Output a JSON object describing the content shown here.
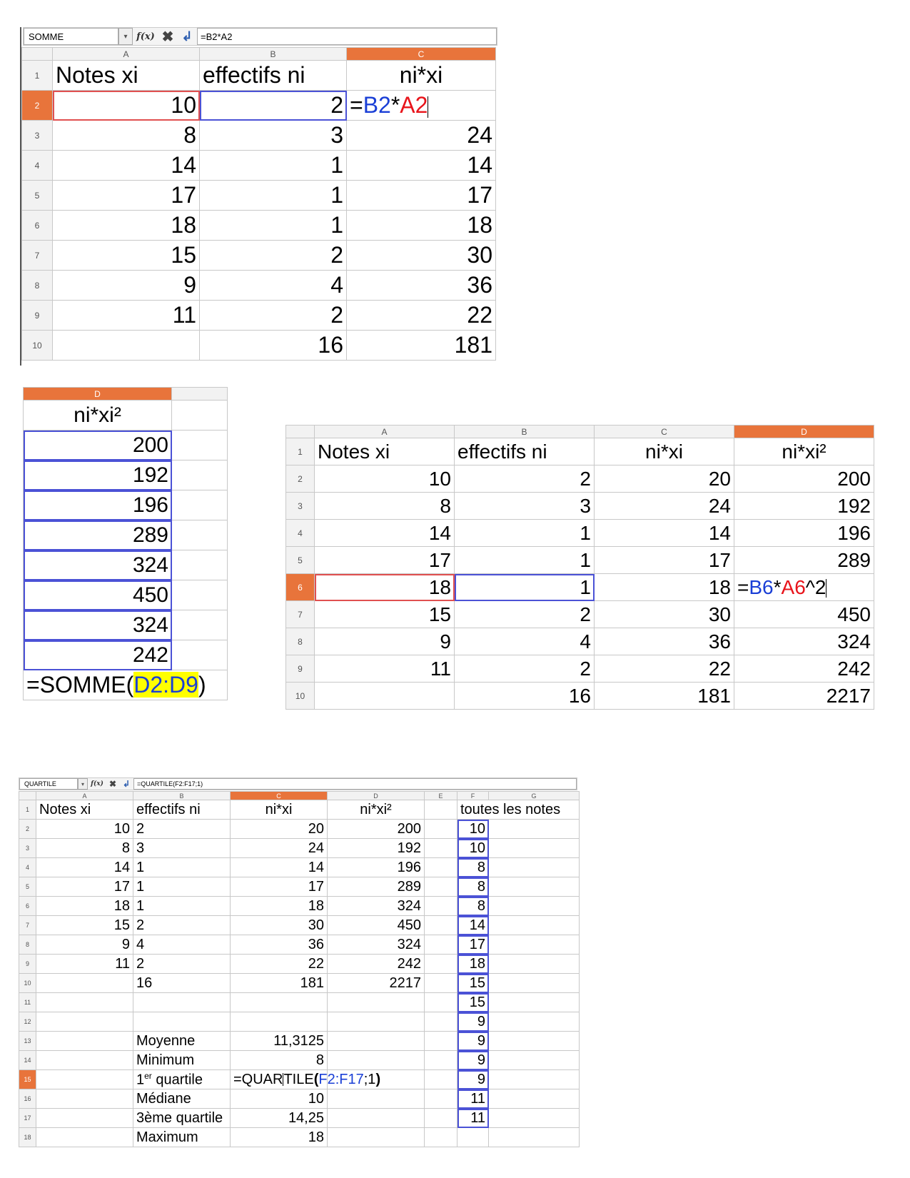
{
  "panel1": {
    "namebox": "SOMME",
    "formula": "=B2*A2",
    "col_headers": [
      "A",
      "B",
      "C"
    ],
    "header_row": [
      "Notes xi",
      "effectifs ni",
      "ni*xi"
    ],
    "row_numbers": [
      "1",
      "2",
      "3",
      "4",
      "5",
      "6",
      "7",
      "8",
      "9",
      "10"
    ],
    "edit_formula": {
      "eq": "=",
      "ref1": "B2",
      "op": "*",
      "ref2": "A2"
    },
    "rows": [
      [
        "10",
        "2",
        ""
      ],
      [
        "8",
        "3",
        "24"
      ],
      [
        "14",
        "1",
        "14"
      ],
      [
        "17",
        "1",
        "17"
      ],
      [
        "18",
        "1",
        "18"
      ],
      [
        "15",
        "2",
        "30"
      ],
      [
        "9",
        "4",
        "36"
      ],
      [
        "11",
        "2",
        "22"
      ],
      [
        "",
        "16",
        "181"
      ]
    ]
  },
  "panel2": {
    "col_header": "D",
    "header": "ni*xi²",
    "values": [
      "200",
      "192",
      "196",
      "289",
      "324",
      "450",
      "324",
      "242"
    ],
    "formula": {
      "prefix": "=SOMME(",
      "range": "D2:D9",
      "suffix": ")"
    }
  },
  "panel3": {
    "col_headers": [
      "A",
      "B",
      "C",
      "D"
    ],
    "header_row": [
      "Notes xi",
      "effectifs ni",
      "ni*xi",
      "ni*xi²"
    ],
    "row_numbers": [
      "1",
      "2",
      "3",
      "4",
      "5",
      "6",
      "7",
      "8",
      "9",
      "10"
    ],
    "edit_formula": {
      "eq": "=",
      "ref1": "B6",
      "op": "*",
      "ref2": "A6",
      "tail": "^2"
    },
    "rows": [
      [
        "10",
        "2",
        "20",
        "200"
      ],
      [
        "8",
        "3",
        "24",
        "192"
      ],
      [
        "14",
        "1",
        "14",
        "196"
      ],
      [
        "17",
        "1",
        "17",
        "289"
      ],
      [
        "18",
        "1",
        "18",
        ""
      ],
      [
        "15",
        "2",
        "30",
        "450"
      ],
      [
        "9",
        "4",
        "36",
        "324"
      ],
      [
        "11",
        "2",
        "22",
        "242"
      ],
      [
        "",
        "16",
        "181",
        "2217"
      ]
    ]
  },
  "panel4": {
    "namebox": "QUARTILE",
    "formula": "=QUARTILE(F2:F17;1)",
    "col_headers": [
      "A",
      "B",
      "C",
      "D",
      "E",
      "F",
      "G"
    ],
    "row_numbers": [
      "1",
      "2",
      "3",
      "4",
      "5",
      "6",
      "7",
      "8",
      "9",
      "10",
      "11",
      "12",
      "13",
      "14",
      "15",
      "16",
      "17",
      "18"
    ],
    "header_row": [
      "Notes xi",
      "effectifs ni",
      "ni*xi",
      "ni*xi²",
      "",
      "toutes les notes",
      ""
    ],
    "rows": [
      [
        "10",
        "2",
        "20",
        "200",
        "",
        "10"
      ],
      [
        "8",
        "3",
        "24",
        "192",
        "",
        "10"
      ],
      [
        "14",
        "1",
        "14",
        "196",
        "",
        "8"
      ],
      [
        "17",
        "1",
        "17",
        "289",
        "",
        "8"
      ],
      [
        "18",
        "1",
        "18",
        "324",
        "",
        "8"
      ],
      [
        "15",
        "2",
        "30",
        "450",
        "",
        "14"
      ],
      [
        "9",
        "4",
        "36",
        "324",
        "",
        "17"
      ],
      [
        "11",
        "2",
        "22",
        "242",
        "",
        "18"
      ],
      [
        "",
        "16",
        "181",
        "2217",
        "",
        "15"
      ],
      [
        "",
        "",
        "",
        "",
        "",
        "15"
      ],
      [
        "",
        "",
        "",
        "",
        "",
        "9"
      ],
      [
        "",
        "Moyenne",
        "11,3125",
        "",
        "",
        "9"
      ],
      [
        "",
        "Minimum",
        "8",
        "",
        "",
        "9"
      ],
      [
        "",
        "1er quartile",
        "",
        "",
        "",
        "9"
      ],
      [
        "",
        "Médiane",
        "10",
        "",
        "",
        "11"
      ],
      [
        "",
        "3ème quartile",
        "14,25",
        "",
        "",
        "11"
      ],
      [
        "",
        "Maximum",
        "18",
        "",
        "",
        ""
      ]
    ],
    "q1_label": {
      "main": "1",
      "sup": "er",
      "rest": " quartile"
    },
    "edit_formula": {
      "a": "=QUAR",
      "b": "TILE",
      "p1": "(",
      "range": "F2:F17",
      "sep": ";1",
      "p2": ")"
    }
  },
  "icons": [
    "function-wizard-icon",
    "cancel-x-icon",
    "accept-enter-icon",
    "dropdown-arrow-icon"
  ],
  "colors": {
    "selected_header": "#e8743b",
    "ref_blue": "#1a3fd6",
    "ref_red": "#e8141b",
    "highlight": "#ffff00"
  }
}
